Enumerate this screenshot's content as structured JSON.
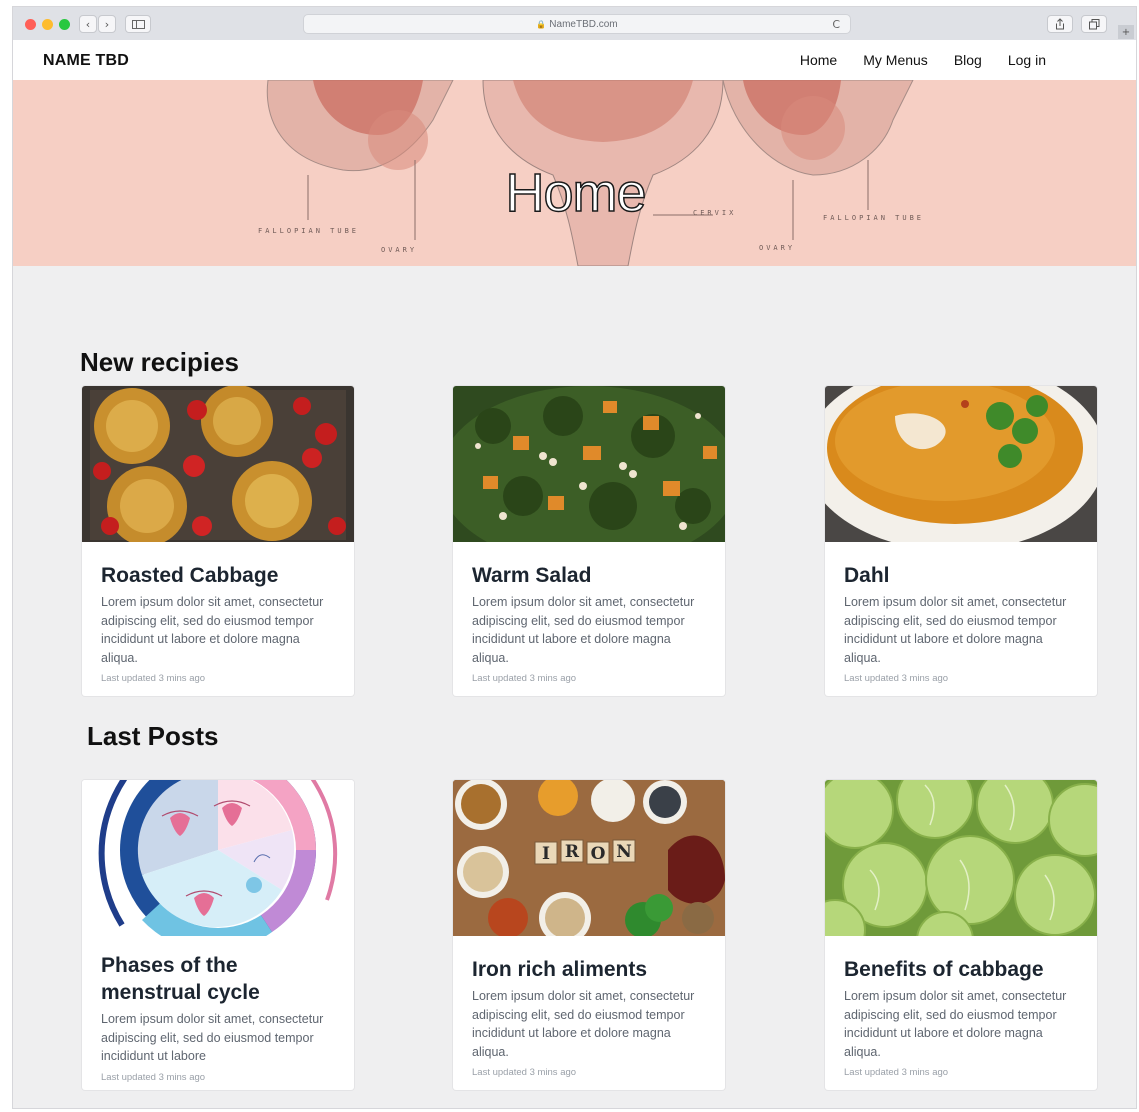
{
  "browser": {
    "url": "NameTBD.com",
    "reload_icon": "C",
    "lights": [
      "#ff5f57",
      "#febc2e",
      "#28c840"
    ]
  },
  "navbar": {
    "brand": "NAME TBD",
    "links": [
      "Home",
      "My Menus",
      "Blog",
      "Log in"
    ]
  },
  "hero": {
    "title": "Home",
    "labels": [
      "FALLOPIAN TUBE",
      "OVARY",
      "CERVIX",
      "OVARY",
      "FALLOPIAN TUBE"
    ],
    "bg_color": "#f6cfc4"
  },
  "recipes": {
    "title": "New recipies",
    "cards": [
      {
        "title": "Roasted Cabbage",
        "text": "Lorem ipsum dolor sit amet, consectetur adipiscing elit, sed do eiusmod tempor incididunt ut labore et dolore magna aliqua.",
        "meta": "Last updated 3 mins ago"
      },
      {
        "title": "Warm Salad",
        "text": "Lorem ipsum dolor sit amet, consectetur adipiscing elit, sed do eiusmod tempor incididunt ut labore et dolore magna aliqua.",
        "meta": "Last updated 3 mins ago"
      },
      {
        "title": "Dahl",
        "text": "Lorem ipsum dolor sit amet, consectetur adipiscing elit, sed do eiusmod tempor incididunt ut labore et dolore magna aliqua.",
        "meta": "Last updated 3 mins ago"
      }
    ]
  },
  "posts": {
    "title": "Last Posts",
    "cards": [
      {
        "title": "Phases of the menstrual cycle",
        "text": "Lorem ipsum dolor sit amet, consectetur adipiscing elit, sed do eiusmod tempor incididunt ut labore",
        "meta": "Last updated 3 mins ago"
      },
      {
        "title": "Iron rich aliments",
        "text": "Lorem ipsum dolor sit amet, consectetur adipiscing elit, sed do eiusmod tempor incididunt ut labore et dolore magna aliqua.",
        "meta": "Last updated 3 mins ago"
      },
      {
        "title": "Benefits of cabbage",
        "text": "Lorem ipsum dolor sit amet, consectetur adipiscing elit, sed do eiusmod tempor incididunt ut labore et dolore magna aliqua.",
        "meta": "Last updated 3 mins ago"
      }
    ],
    "iron_tiles": [
      "I",
      "R",
      "O",
      "N"
    ]
  }
}
